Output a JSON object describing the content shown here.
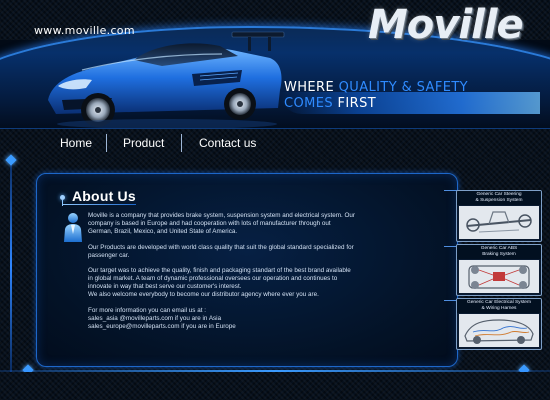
{
  "header": {
    "url": "www.moville.com",
    "logo": "Moville",
    "tagline": {
      "line1_white": "WHERE",
      "line1_blue": "QUALITY & SAFETY",
      "line2_blue": "COMES",
      "line2_white": "FIRST"
    }
  },
  "nav": {
    "items": [
      {
        "label": "Home"
      },
      {
        "label": "Product"
      },
      {
        "label": "Contact us"
      }
    ]
  },
  "about": {
    "title": "About Us",
    "paragraphs": [
      [
        "Moville is a company that provides brake system, suspension system and electrical system. Our",
        "company is based in Europe and had cooperation with lots of manufacturer through out",
        "German, Brazil, Mexico, and United State of America."
      ],
      [
        "Our Products are developed with world class quality that suit the global standard specialized for",
        "passenger car."
      ],
      [
        "Our target was to achieve the quality, finish and packaging standart of the best brand available",
        "in global market. A team of dynamic professional oversees our operation and continues to",
        "innovate in way that best serve our customer's interest.",
        "We also welcome everybody to become our distributor agency where ever you are."
      ],
      [
        "For more information you can email us at :",
        "sales_asia @movilleparts.com if you are in Asia",
        "sales_europe@movilleparts.com if you are in Europe"
      ]
    ]
  },
  "products": [
    {
      "title_lines": [
        "Generic Car Steering",
        "& Suspension System"
      ]
    },
    {
      "title_lines": [
        "Generic Car ABS",
        "Braking System"
      ]
    },
    {
      "title_lines": [
        "Generic Car Electrical System",
        "& Wiring Harnes"
      ]
    }
  ],
  "colors": {
    "accent": "#2f8bff",
    "frame_border": "#1d67c9",
    "background": "#020a16"
  },
  "icons": {
    "about": "person-icon",
    "title_bullet": "bullet-dot-icon"
  }
}
